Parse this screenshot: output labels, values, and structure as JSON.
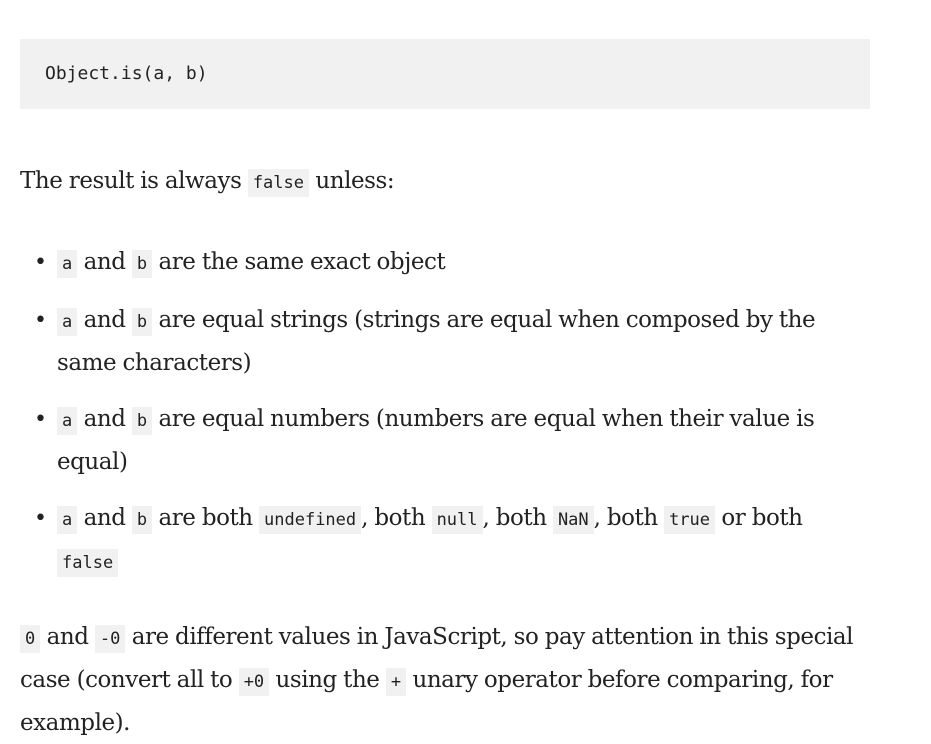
{
  "code_block": {
    "text": "Object.is(a, b)"
  },
  "intro": {
    "before": "The result is always ",
    "code": "false",
    "after": " unless:"
  },
  "conditions": [
    {
      "code_a": "a",
      "mid1": " and ",
      "code_b": "b",
      "text": " are the same exact object"
    },
    {
      "code_a": "a",
      "mid1": " and ",
      "code_b": "b",
      "text": " are equal strings (strings are equal when composed by the same characters)"
    },
    {
      "code_a": "a",
      "mid1": " and ",
      "code_b": "b",
      "text": " are equal numbers (numbers are equal when their value is equal)"
    },
    {
      "code_a": "a",
      "mid1": " and ",
      "code_b": "b",
      "t1": " are both ",
      "c1": "undefined",
      "t2": ", both ",
      "c2": "null",
      "t3": ", both ",
      "c3": "NaN",
      "t4": ", both ",
      "c4": "true",
      "t5": " or both ",
      "c5": "false"
    }
  ],
  "note": {
    "c1": "0",
    "t1": " and ",
    "c2": "-0",
    "t2": " are different values in JavaScript, so pay attention in this special case (convert all to ",
    "c3": "+0",
    "t3": " using the ",
    "c4": "+",
    "t4": " unary operator before comparing, for example)."
  }
}
